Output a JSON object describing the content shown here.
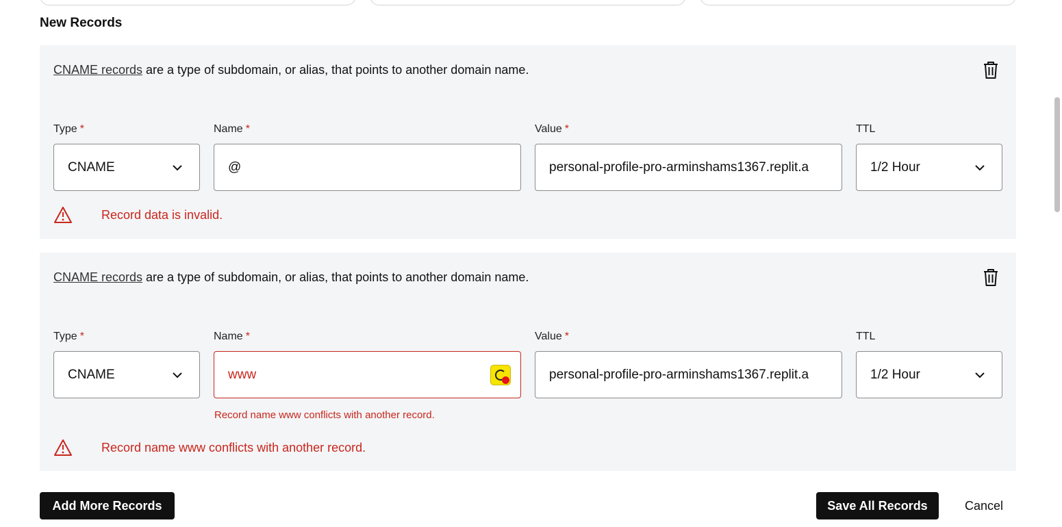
{
  "section_title": "New Records",
  "records": [
    {
      "description_link": "CNAME records",
      "description_rest": " are a type of subdomain, or alias, that points to another domain name.",
      "labels": {
        "type": "Type",
        "name": "Name",
        "value": "Value",
        "ttl": "TTL"
      },
      "required_mark": "*",
      "type_value": "CNAME",
      "name_value": "@",
      "value_value": "personal-profile-pro-arminshams1367.replit.a",
      "ttl_value": "1/2 Hour",
      "alert_text": "Record data is invalid."
    },
    {
      "description_link": "CNAME records",
      "description_rest": " are a type of subdomain, or alias, that points to another domain name.",
      "labels": {
        "type": "Type",
        "name": "Name",
        "value": "Value",
        "ttl": "TTL"
      },
      "required_mark": "*",
      "type_value": "CNAME",
      "name_value": "www",
      "name_error": "Record name www conflicts with another record.",
      "value_value": "personal-profile-pro-arminshams1367.replit.a",
      "ttl_value": "1/2 Hour",
      "alert_text": "Record name www conflicts with another record."
    }
  ],
  "actions": {
    "add_more": "Add More Records",
    "save_all": "Save All Records",
    "cancel": "Cancel"
  },
  "colors": {
    "error": "#c8271d",
    "card_bg": "#f4f5f7",
    "button_dark": "#111111"
  },
  "icons": {
    "delete": "trash-icon",
    "alert": "warning-triangle-icon",
    "dropdown": "chevron-down-icon",
    "extension": "password-manager-icon"
  }
}
